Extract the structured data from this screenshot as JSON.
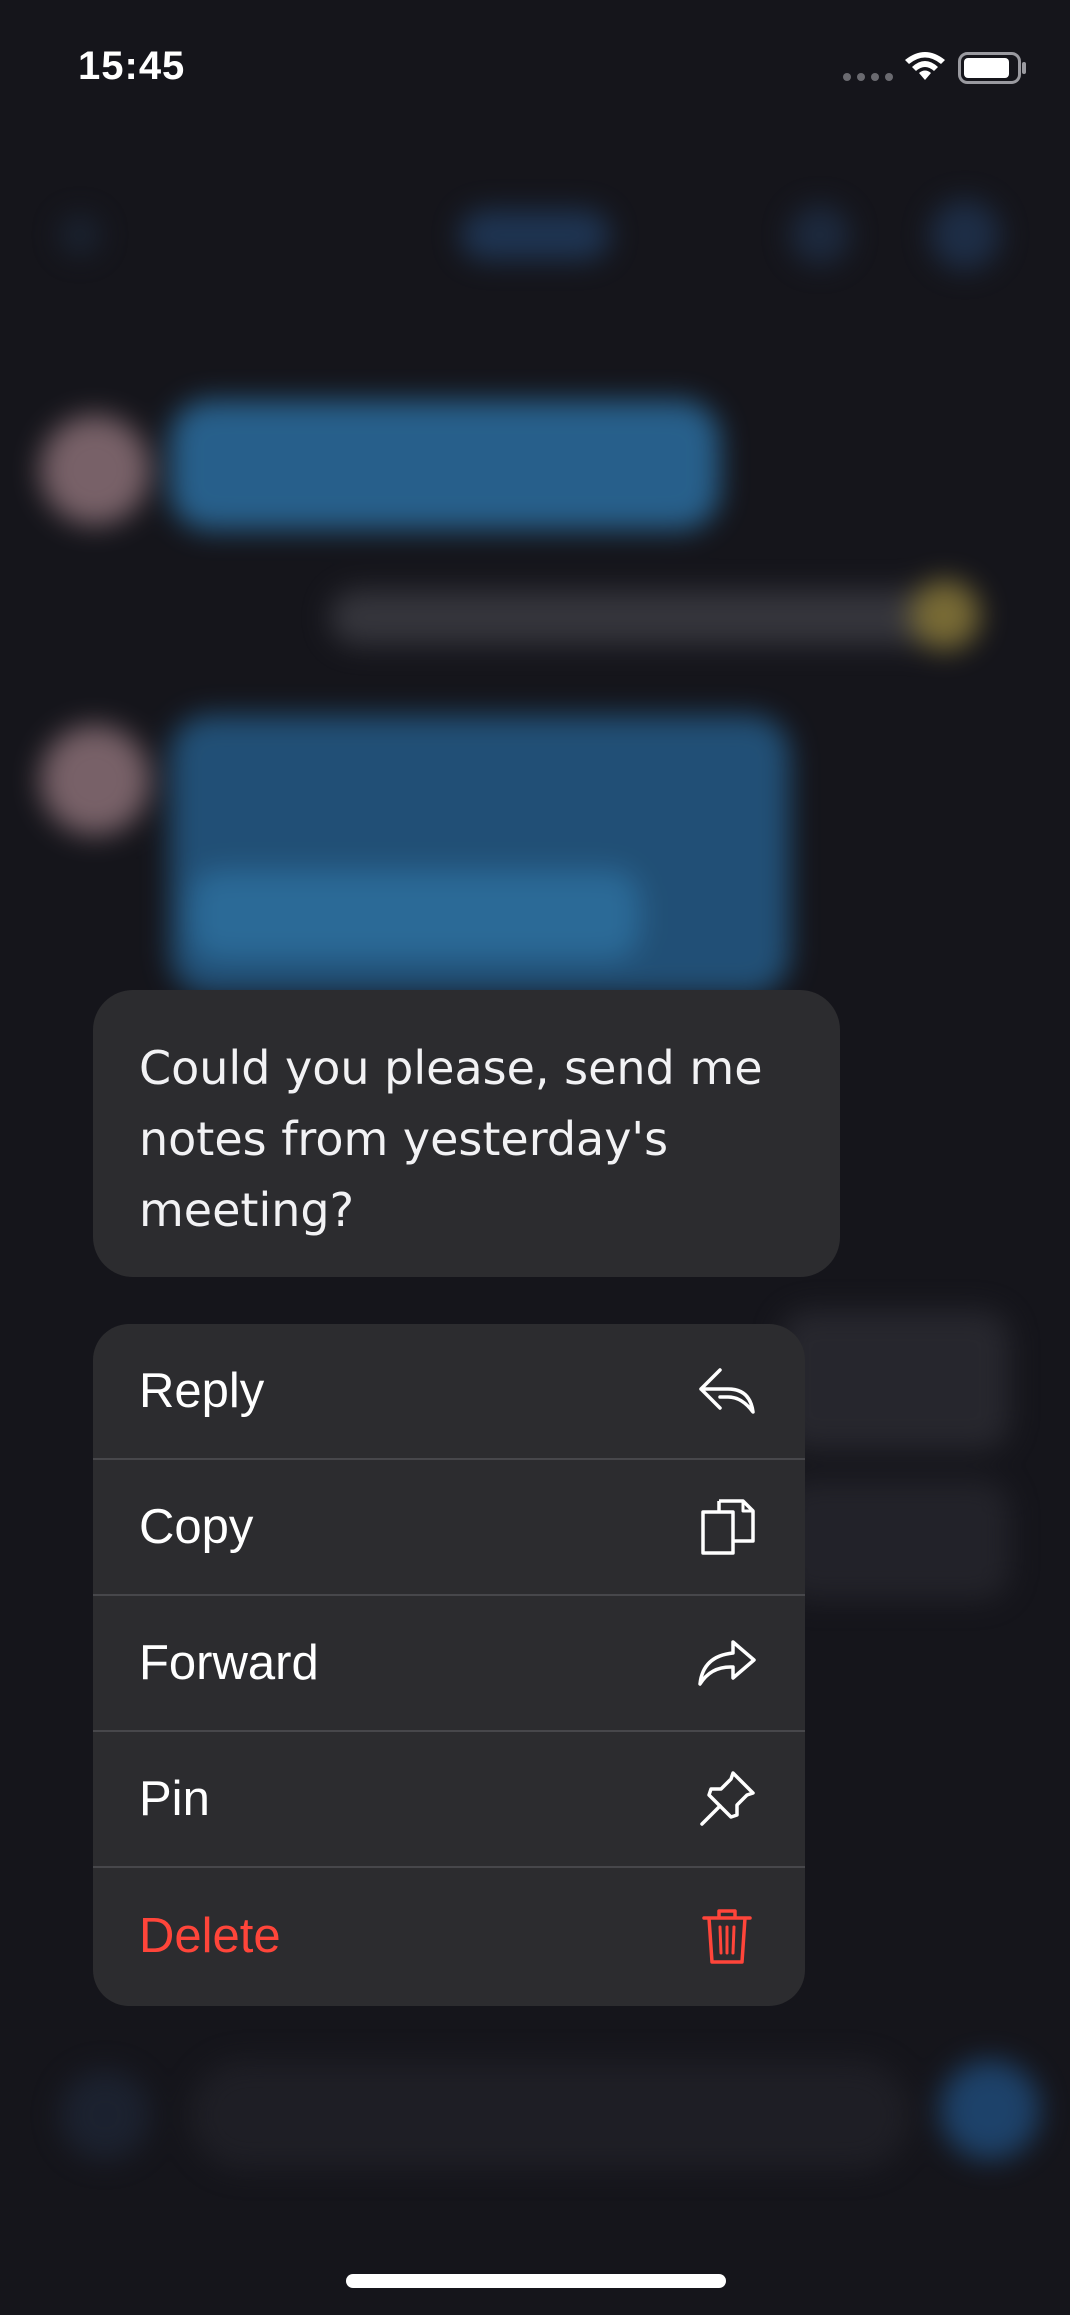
{
  "status_bar": {
    "time": "15:45"
  },
  "message": {
    "text": "Could you please, send me notes from yesterday's meeting?"
  },
  "context_menu": {
    "items": [
      {
        "label": "Reply",
        "icon": "reply-icon"
      },
      {
        "label": "Copy",
        "icon": "copy-icon"
      },
      {
        "label": "Forward",
        "icon": "forward-icon"
      },
      {
        "label": "Pin",
        "icon": "pin-icon"
      },
      {
        "label": "Delete",
        "icon": "trash-icon",
        "destructive": true
      }
    ]
  },
  "colors": {
    "background": "#15151b",
    "menu_background": "#2c2c2f",
    "destructive": "#ff453a",
    "text": "#ffffff"
  }
}
